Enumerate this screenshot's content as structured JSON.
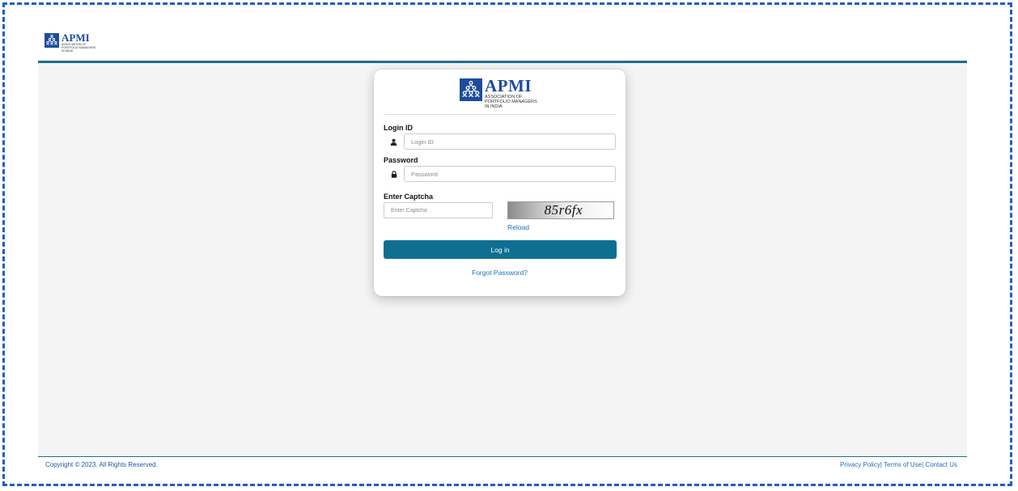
{
  "brand": {
    "name": "APMI",
    "subtitle_lines": [
      "ASSOCIATION OF",
      "PORTFOLIO MANAGERS",
      "IN INDIA"
    ]
  },
  "login_form": {
    "login_id_label": "Login ID",
    "login_id_placeholder": "Login ID",
    "password_label": "Password",
    "password_placeholder": "Password",
    "captcha_label": "Enter Captcha",
    "captcha_placeholder": "Enter Captcha",
    "captcha_text": "85r6fx",
    "reload_label": "Reload",
    "login_button_label": "Log in",
    "forgot_password_label": "Forgot Password?"
  },
  "footer": {
    "copyright": "Copyright © 2023. All Rights Reserved.",
    "privacy_policy": "Privacy Policy",
    "terms_of_use": "Terms of Use",
    "contact_us": "Contact Us",
    "separator": "|"
  },
  "colors": {
    "brand_blue": "#1e4c9c",
    "header_rule": "#1b6e8e",
    "button": "#0e6f91",
    "link": "#1d6fb8",
    "page_background": "#f4f4f4"
  },
  "icons": {
    "logo": "apmi-people-triangle-icon",
    "login_id_addon": "user-icon",
    "password_addon": "lock-icon"
  }
}
